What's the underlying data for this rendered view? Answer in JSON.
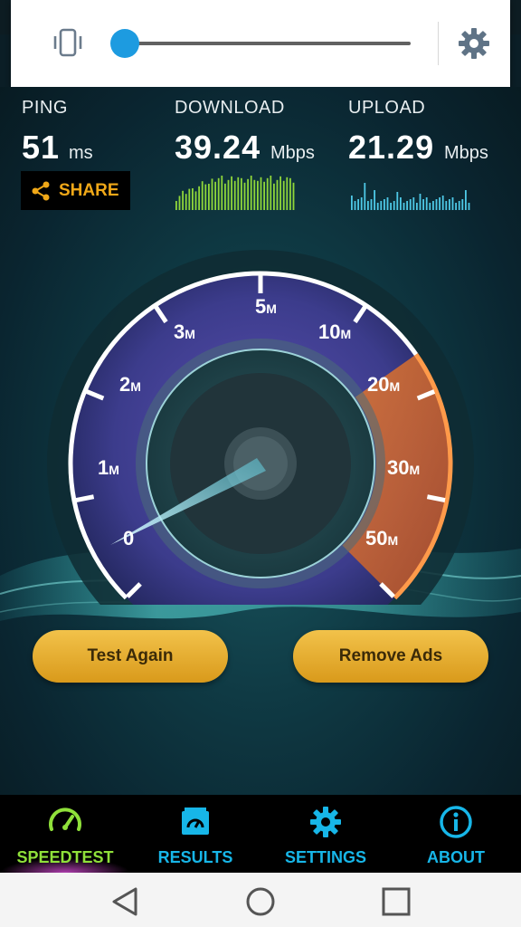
{
  "colors": {
    "accent_blue": "#1d9be0",
    "share_orange": "#f0a818",
    "speedtest_green": "#8fe03a",
    "tab_blue": "#17b6e8",
    "button_gold": "#e0a82a"
  },
  "volume_panel": {
    "vibrate_icon": "vibrate-icon",
    "level": 0.0,
    "settings_icon": "gear-icon"
  },
  "stats": {
    "ping": {
      "label": "PING",
      "value": "51",
      "unit": "ms"
    },
    "download": {
      "label": "DOWNLOAD",
      "value": "39.24",
      "unit": "Mbps"
    },
    "upload": {
      "label": "UPLOAD",
      "value": "21.29",
      "unit": "Mbps"
    }
  },
  "share": {
    "label": "SHARE",
    "icon": "share-icon"
  },
  "gauge": {
    "ticks": [
      {
        "num": "0",
        "unit": ""
      },
      {
        "num": "1",
        "unit": "M"
      },
      {
        "num": "2",
        "unit": "M"
      },
      {
        "num": "3",
        "unit": "M"
      },
      {
        "num": "5",
        "unit": "M"
      },
      {
        "num": "10",
        "unit": "M"
      },
      {
        "num": "20",
        "unit": "M"
      },
      {
        "num": "30",
        "unit": "M"
      },
      {
        "num": "50",
        "unit": "M"
      }
    ]
  },
  "buttons": {
    "test_again": "Test Again",
    "remove_ads": "Remove Ads"
  },
  "tabs": [
    {
      "label": "SPEEDTEST",
      "icon": "speedometer-icon",
      "active": true
    },
    {
      "label": "RESULTS",
      "icon": "results-icon",
      "active": false
    },
    {
      "label": "SETTINGS",
      "icon": "gear-icon",
      "active": false
    },
    {
      "label": "ABOUT",
      "icon": "info-icon",
      "active": false
    }
  ],
  "system_nav": {
    "back": "back-icon",
    "home": "home-icon",
    "recents": "recents-icon"
  }
}
